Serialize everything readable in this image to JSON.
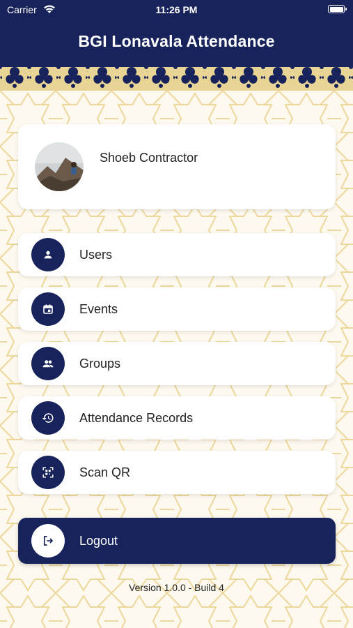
{
  "status_bar": {
    "carrier": "Carrier",
    "time": "11:26 PM"
  },
  "header": {
    "title": "BGI Lonavala Attendance"
  },
  "profile": {
    "name": "Shoeb Contractor"
  },
  "menu": {
    "items": [
      {
        "label": "Users",
        "icon": "person-icon"
      },
      {
        "label": "Events",
        "icon": "calendar-icon"
      },
      {
        "label": "Groups",
        "icon": "group-icon"
      },
      {
        "label": "Attendance Records",
        "icon": "history-icon"
      },
      {
        "label": "Scan QR",
        "icon": "qr-scan-icon"
      }
    ]
  },
  "logout": {
    "label": "Logout",
    "icon": "logout-icon"
  },
  "footer": {
    "version": "Version 1.0.0 - Build 4"
  },
  "colors": {
    "primary": "#17235a",
    "pattern_line": "#e6cf8f",
    "background": "#fdf9ee"
  }
}
